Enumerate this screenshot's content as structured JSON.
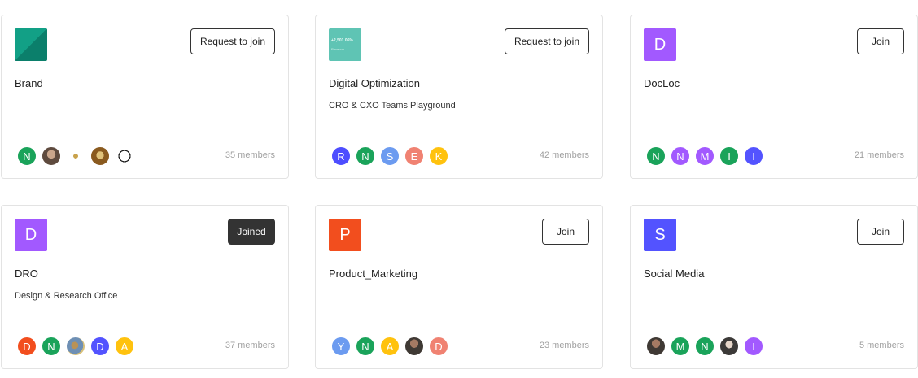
{
  "cards": [
    {
      "name": "Brand",
      "description": "",
      "action": "Request to join",
      "logo": {
        "type": "image",
        "colors": [
          "#12a086",
          "#0b7f6b"
        ]
      },
      "avatars": [
        {
          "letter": "N",
          "color": "#1aa35a"
        },
        {
          "letter": "",
          "photo": "photo-a"
        },
        {
          "letter": "",
          "photo": "photo-x"
        },
        {
          "letter": "",
          "photo": "photo-b"
        },
        {
          "letter": "",
          "photo": "photo-c"
        }
      ],
      "members": "35 members"
    },
    {
      "name": "Digital Optimization",
      "description": "CRO & CXO Teams Playground",
      "action": "Request to join",
      "logo": {
        "type": "image",
        "colors": [
          "#5fc4b4"
        ],
        "text": "+2,501.06%",
        "subtext": "Revenue"
      },
      "avatars": [
        {
          "letter": "R",
          "color": "#4d4dff"
        },
        {
          "letter": "N",
          "color": "#1aa35a"
        },
        {
          "letter": "S",
          "color": "#6c9bf0"
        },
        {
          "letter": "E",
          "color": "#f08272"
        },
        {
          "letter": "K",
          "color": "#ffc20e"
        }
      ],
      "members": "42 members"
    },
    {
      "name": "DocLoc",
      "description": "",
      "action": "Join",
      "logo": {
        "type": "letter",
        "letter": "D",
        "color": "#a259ff"
      },
      "avatars": [
        {
          "letter": "N",
          "color": "#1aa35a"
        },
        {
          "letter": "N",
          "color": "#a259ff"
        },
        {
          "letter": "M",
          "color": "#a259ff"
        },
        {
          "letter": "I",
          "color": "#1aa35a"
        },
        {
          "letter": "I",
          "color": "#5353ff"
        }
      ],
      "members": "21 members"
    },
    {
      "name": "DRO",
      "description": "Design & Research Office",
      "action": "Joined",
      "logo": {
        "type": "letter",
        "letter": "D",
        "color": "#a259ff"
      },
      "avatars": [
        {
          "letter": "D",
          "color": "#f24e1e"
        },
        {
          "letter": "N",
          "color": "#1aa35a"
        },
        {
          "letter": "",
          "photo": "photo-d"
        },
        {
          "letter": "D",
          "color": "#5353ff"
        },
        {
          "letter": "A",
          "color": "#ffc20e"
        }
      ],
      "members": "37 members"
    },
    {
      "name": "Product_Marketing",
      "description": "",
      "action": "Join",
      "logo": {
        "type": "letter",
        "letter": "P",
        "color": "#f24e1e"
      },
      "avatars": [
        {
          "letter": "Y",
          "color": "#6c9bf0"
        },
        {
          "letter": "N",
          "color": "#1aa35a"
        },
        {
          "letter": "A",
          "color": "#ffc20e"
        },
        {
          "letter": "",
          "photo": "photo-e"
        },
        {
          "letter": "D",
          "color": "#f08272"
        }
      ],
      "members": "23 members"
    },
    {
      "name": "Social Media",
      "description": "",
      "action": "Join",
      "logo": {
        "type": "letter",
        "letter": "S",
        "color": "#5353ff"
      },
      "avatars": [
        {
          "letter": "",
          "photo": "photo-e"
        },
        {
          "letter": "M",
          "color": "#1aa35a"
        },
        {
          "letter": "N",
          "color": "#1aa35a"
        },
        {
          "letter": "",
          "photo": "photo-f"
        },
        {
          "letter": "I",
          "color": "#a259ff"
        }
      ],
      "members": "5 members"
    }
  ]
}
